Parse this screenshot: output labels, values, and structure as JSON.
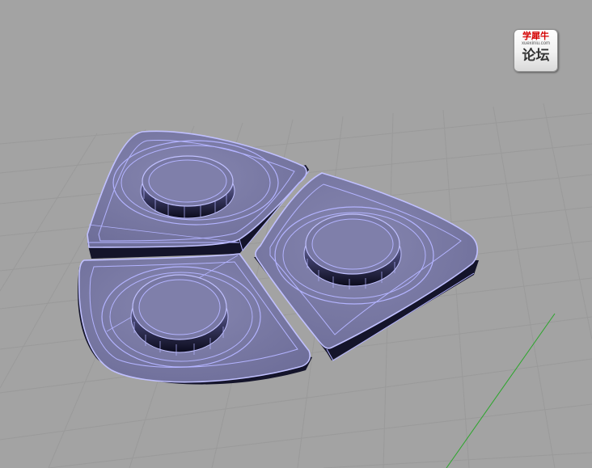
{
  "watermark": {
    "brand": "学犀牛",
    "domain": "xuexiniu.com",
    "forum": "论坛"
  },
  "colors": {
    "background": "#a3a3a3",
    "grid_line": "#999999",
    "grid_axis_green": "#2aa62a",
    "surface_face": "#7b7ba5",
    "surface_edge": "#b3b3ff",
    "surface_shadow": "#15152a"
  },
  "viewport": {
    "view": "perspective",
    "grid": true,
    "object": "three-lobed spinner, wireframe shaded"
  }
}
